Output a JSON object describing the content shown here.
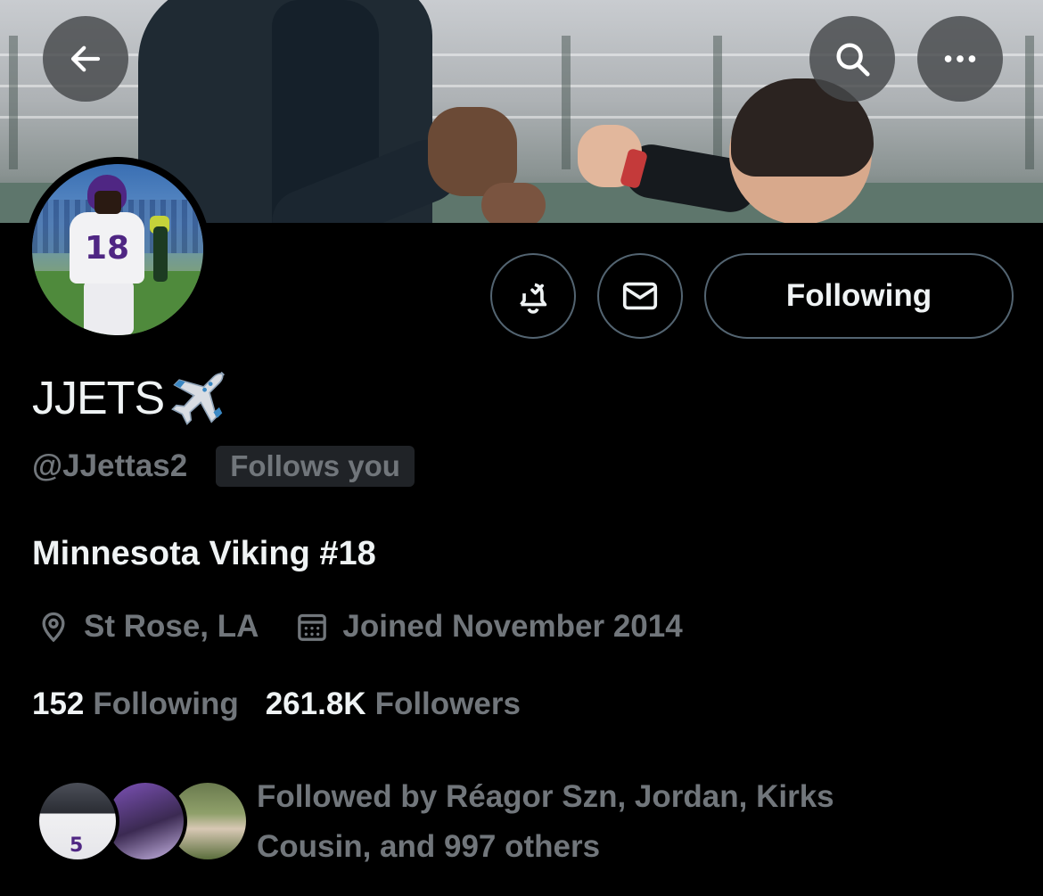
{
  "header": {
    "back_icon": "arrow-left-icon",
    "search_icon": "search-icon",
    "more_icon": "more-horizontal-icon"
  },
  "profile": {
    "display_name": "JJETS",
    "name_emoji_icon": "airplane-icon",
    "handle": "@JJettas2",
    "follows_you_badge": "Follows you",
    "bio": "Minnesota Viking #18",
    "location": "St Rose, LA",
    "joined": "Joined November 2014",
    "avatar_jersey_number": "18"
  },
  "actions": {
    "notify_icon": "bell-check-icon",
    "message_icon": "envelope-icon",
    "following_label": "Following"
  },
  "stats": {
    "following_count": "152",
    "following_label": "Following",
    "followers_count": "261.8K",
    "followers_label": "Followers"
  },
  "followed_by": {
    "text": "Followed by Réagor Szn, Jordan, Kirks Cousin, and 997 others",
    "first_avatar_number": "5"
  },
  "colors": {
    "background": "#000000",
    "primary_text": "#eff3f4",
    "secondary_text": "#71767b",
    "border": "#536471",
    "badge_bg": "#202327"
  }
}
